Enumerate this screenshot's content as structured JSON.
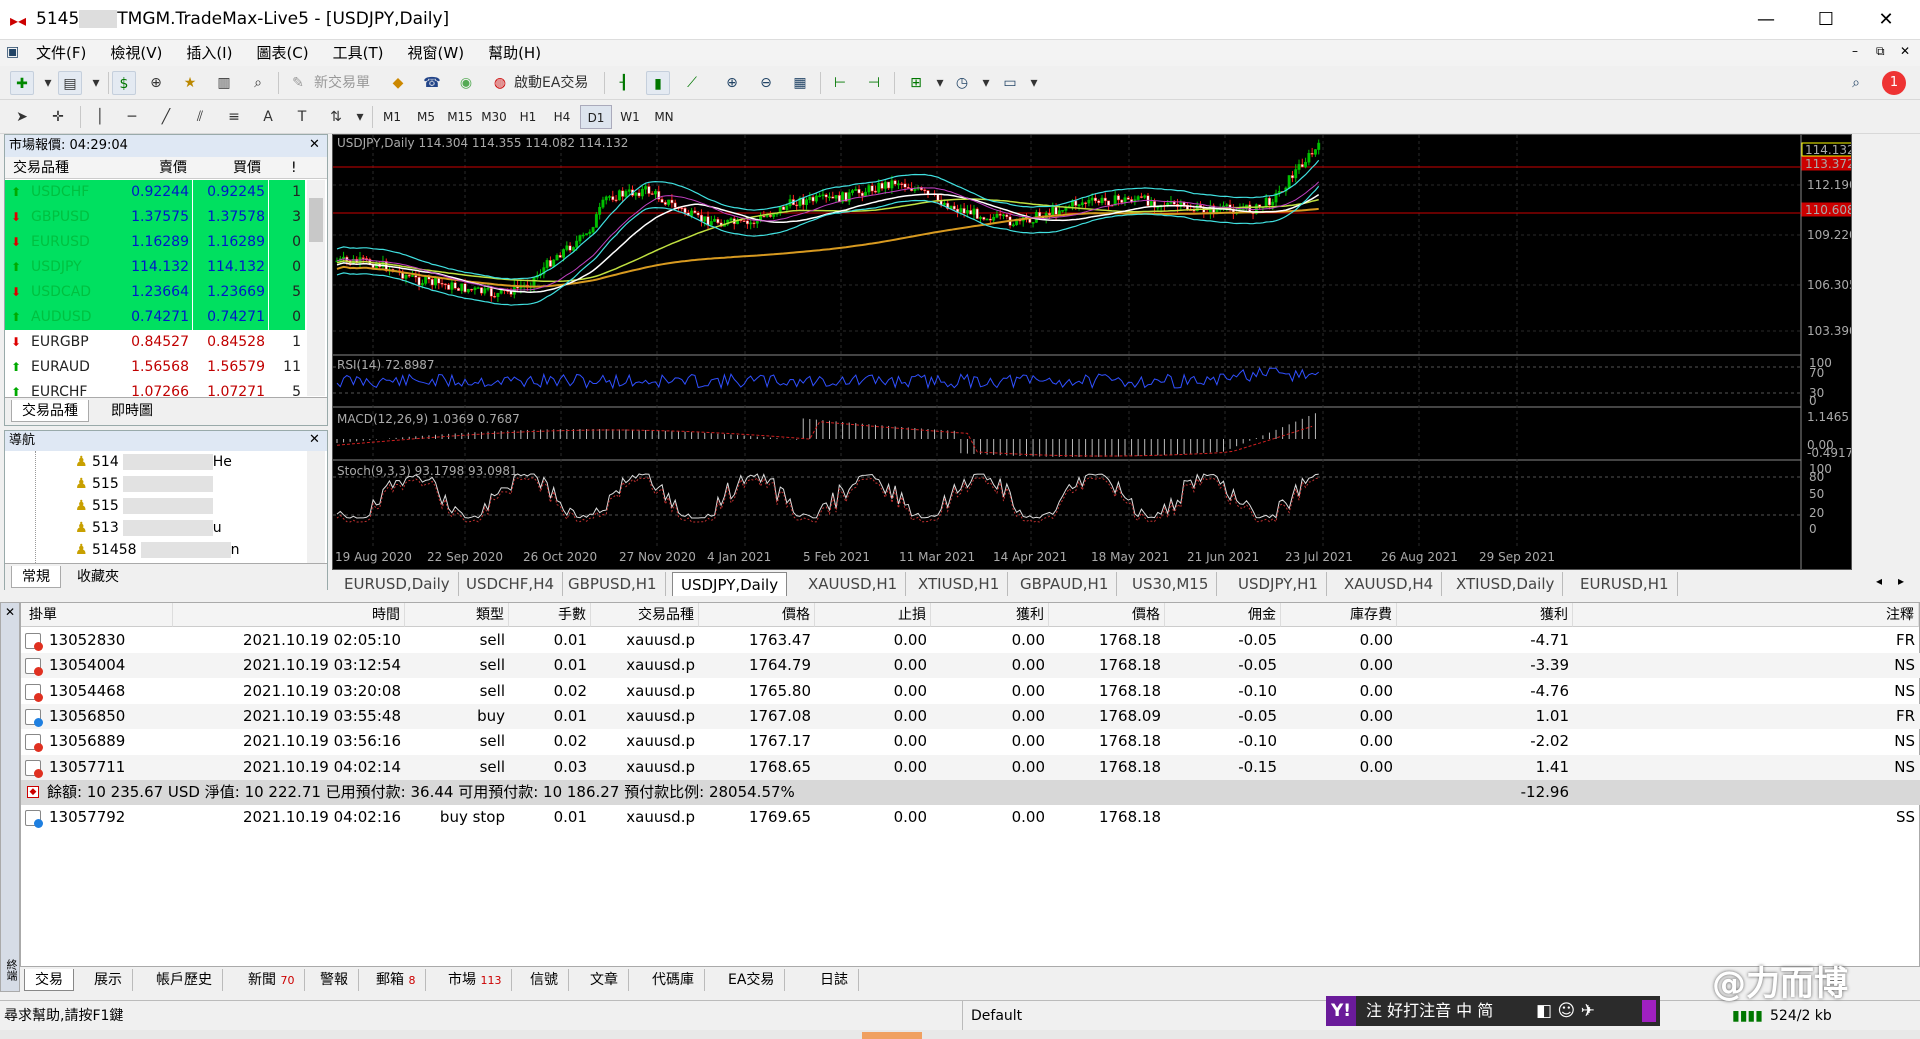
{
  "window": {
    "title_prefix": "5145",
    "title_suffix": "TMGM.TradeMax-Live5 - [USDJPY,Daily]"
  },
  "menu": [
    "文件(F)",
    "檢視(V)",
    "插入(I)",
    "圖表(C)",
    "工具(T)",
    "視窗(W)",
    "幫助(H)"
  ],
  "toolbar": {
    "new_order_label": "新交易單",
    "autotrade_label": "啟動EA交易",
    "timeframes": [
      "M1",
      "M5",
      "M15",
      "M30",
      "H1",
      "H4",
      "D1",
      "W1",
      "MN"
    ],
    "notification_count": "1"
  },
  "market_watch": {
    "title": "市場報價: 04:29:04",
    "columns": [
      "交易品種",
      "賣價",
      "買價",
      "!"
    ],
    "rows": [
      {
        "symbol": "USDCHF",
        "bid": "0.92244",
        "ask": "0.92245",
        "spread": "1",
        "up": true,
        "highlight": true
      },
      {
        "symbol": "GBPUSD",
        "bid": "1.37575",
        "ask": "1.37578",
        "spread": "3",
        "up": false,
        "highlight": true
      },
      {
        "symbol": "EURUSD",
        "bid": "1.16289",
        "ask": "1.16289",
        "spread": "0",
        "up": false,
        "highlight": true
      },
      {
        "symbol": "USDJPY",
        "bid": "114.132",
        "ask": "114.132",
        "spread": "0",
        "up": true,
        "highlight": true
      },
      {
        "symbol": "USDCAD",
        "bid": "1.23664",
        "ask": "1.23669",
        "spread": "5",
        "up": false,
        "highlight": true
      },
      {
        "symbol": "AUDUSD",
        "bid": "0.74271",
        "ask": "0.74271",
        "spread": "0",
        "up": true,
        "highlight": true
      },
      {
        "symbol": "EURGBP",
        "bid": "0.84527",
        "ask": "0.84528",
        "spread": "1",
        "up": false,
        "highlight": false
      },
      {
        "symbol": "EURAUD",
        "bid": "1.56568",
        "ask": "1.56579",
        "spread": "11",
        "up": true,
        "highlight": false
      },
      {
        "symbol": "EURCHF",
        "bid": "1.07266",
        "ask": "1.07271",
        "spread": "5",
        "up": true,
        "highlight": false
      }
    ],
    "tabs": [
      "交易品種",
      "即時圖"
    ]
  },
  "navigator": {
    "title": "導航",
    "accounts": [
      "514",
      "515",
      "515",
      "513",
      "51458"
    ],
    "account_suffixes": [
      "He",
      "",
      "",
      "u",
      "n"
    ],
    "tabs": [
      "常規",
      "收藏夾"
    ]
  },
  "chart": {
    "header": "USDJPY,Daily  114.304 114.355 114.082 114.132",
    "rsi_label": "RSI(14) 72.8987",
    "macd_label": "MACD(12,26,9) 1.0369 0.7687",
    "stoch_label": "Stoch(9,3,3) 93.1798 93.0981",
    "price_labels": [
      "112.190",
      "109.220",
      "106.305",
      "103.390"
    ],
    "price_tags": [
      "114.132",
      "113.372",
      "110.608"
    ],
    "rsi_levels": [
      "100",
      "70",
      "30",
      "0"
    ],
    "macd_levels": [
      "1.1465",
      "0.00",
      "-0.4917"
    ],
    "stoch_levels": [
      "100",
      "80",
      "50",
      "20",
      "0"
    ],
    "dates": [
      "19 Aug 2020",
      "22 Sep 2020",
      "26 Oct 2020",
      "27 Nov 2020",
      "4 Jan 2021",
      "5 Feb 2021",
      "11 Mar 2021",
      "14 Apr 2021",
      "18 May 2021",
      "21 Jun 2021",
      "23 Jul 2021",
      "26 Aug 2021",
      "29 Sep 2021"
    ],
    "colors": {
      "bull": "#00c000",
      "bear": "#ff2020",
      "bg": "#000000"
    }
  },
  "chart_tabs": [
    "EURUSD,Daily",
    "USDCHF,H4",
    "GBPUSD,H1",
    "USDJPY,Daily",
    "XAUUSD,H1",
    "XTIUSD,H1",
    "GBPAUD,H1",
    "US30,M15",
    "USDJPY,H1",
    "XAUUSD,H4",
    "XTIUSD,Daily",
    "EURUSD,H1"
  ],
  "terminal": {
    "columns": [
      "掛單",
      "時間",
      "類型",
      "手數",
      "交易品種",
      "價格",
      "止損",
      "獲利",
      "價格",
      "佣金",
      "庫存費",
      "獲利",
      "注釋"
    ],
    "orders": [
      {
        "ticket": "13052830",
        "time": "2021.10.19 02:05:10",
        "type": "sell",
        "lots": "0.01",
        "symbol": "xauusd.p",
        "price": "1763.47",
        "sl": "0.00",
        "tp": "0.00",
        "cur": "1768.18",
        "comm": "-0.05",
        "swap": "0.00",
        "profit": "-4.71",
        "comment": "FR",
        "buy": false
      },
      {
        "ticket": "13054004",
        "time": "2021.10.19 03:12:54",
        "type": "sell",
        "lots": "0.01",
        "symbol": "xauusd.p",
        "price": "1764.79",
        "sl": "0.00",
        "tp": "0.00",
        "cur": "1768.18",
        "comm": "-0.05",
        "swap": "0.00",
        "profit": "-3.39",
        "comment": "NS",
        "buy": false
      },
      {
        "ticket": "13054468",
        "time": "2021.10.19 03:20:08",
        "type": "sell",
        "lots": "0.02",
        "symbol": "xauusd.p",
        "price": "1765.80",
        "sl": "0.00",
        "tp": "0.00",
        "cur": "1768.18",
        "comm": "-0.10",
        "swap": "0.00",
        "profit": "-4.76",
        "comment": "NS",
        "buy": false
      },
      {
        "ticket": "13056850",
        "time": "2021.10.19 03:55:48",
        "type": "buy",
        "lots": "0.01",
        "symbol": "xauusd.p",
        "price": "1767.08",
        "sl": "0.00",
        "tp": "0.00",
        "cur": "1768.09",
        "comm": "-0.05",
        "swap": "0.00",
        "profit": "1.01",
        "comment": "FR",
        "buy": true
      },
      {
        "ticket": "13056889",
        "time": "2021.10.19 03:56:16",
        "type": "sell",
        "lots": "0.02",
        "symbol": "xauusd.p",
        "price": "1767.17",
        "sl": "0.00",
        "tp": "0.00",
        "cur": "1768.18",
        "comm": "-0.10",
        "swap": "0.00",
        "profit": "-2.02",
        "comment": "NS",
        "buy": false
      },
      {
        "ticket": "13057711",
        "time": "2021.10.19 04:02:14",
        "type": "sell",
        "lots": "0.03",
        "symbol": "xauusd.p",
        "price": "1768.65",
        "sl": "0.00",
        "tp": "0.00",
        "cur": "1768.18",
        "comm": "-0.15",
        "swap": "0.00",
        "profit": "1.41",
        "comment": "NS",
        "buy": false
      }
    ],
    "summary": {
      "text": "餘額: 10 235.67 USD  淨值: 10 222.71  已用預付款: 36.44  可用預付款: 10 186.27  預付款比例: 28054.57%",
      "profit": "-12.96"
    },
    "pending": {
      "ticket": "13057792",
      "time": "2021.10.19 04:02:16",
      "type": "buy stop",
      "lots": "0.01",
      "symbol": "xauusd.p",
      "price": "1769.65",
      "sl": "0.00",
      "tp": "0.00",
      "cur": "1768.18",
      "comment": "SS"
    },
    "side_label": "終端",
    "tabs": [
      {
        "label": "交易",
        "count": ""
      },
      {
        "label": "展示",
        "count": ""
      },
      {
        "label": "帳戶歷史",
        "count": ""
      },
      {
        "label": "新聞",
        "count": "70"
      },
      {
        "label": "警報",
        "count": ""
      },
      {
        "label": "郵箱",
        "count": "8"
      },
      {
        "label": "市場",
        "count": "113"
      },
      {
        "label": "信號",
        "count": ""
      },
      {
        "label": "文章",
        "count": ""
      },
      {
        "label": "代碼庫",
        "count": ""
      },
      {
        "label": "EA交易",
        "count": ""
      },
      {
        "label": "日誌",
        "count": ""
      }
    ]
  },
  "status": {
    "help": "尋求幫助,請按F1鍵",
    "profile": "Default",
    "traffic": "524/2 kb",
    "ime": "注 好打注音  中 简"
  },
  "watermark": "@力而博"
}
